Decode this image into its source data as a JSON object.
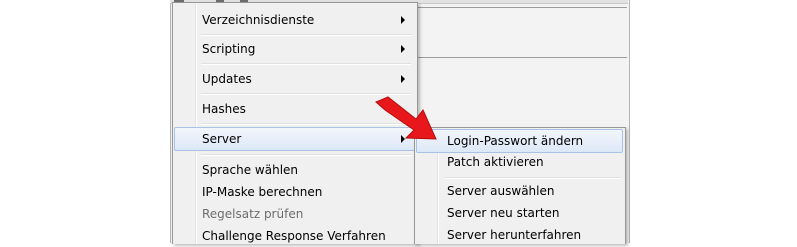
{
  "menu": {
    "items": [
      {
        "label": "Verzeichnisdienste",
        "submenu": true
      },
      {
        "label": "Scripting",
        "submenu": true
      },
      {
        "label": "Updates",
        "submenu": true
      },
      {
        "label": "Hashes",
        "submenu": false
      },
      {
        "label": "Server",
        "submenu": true,
        "state": "open"
      },
      {
        "label": "Sprache wählen",
        "submenu": false
      },
      {
        "label": "IP-Maske berechnen",
        "submenu": false
      },
      {
        "label": "Regelsatz prüfen",
        "submenu": false,
        "state": "disabled"
      },
      {
        "label": "Challenge Response Verfahren",
        "submenu": false
      }
    ]
  },
  "submenu": {
    "items": [
      {
        "label": "Login-Passwort ändern",
        "state": "highlighted"
      },
      {
        "label": "Patch aktivieren"
      },
      {
        "label": "Server auswählen"
      },
      {
        "label": "Server neu starten"
      },
      {
        "label": "Server herunterfahren"
      }
    ]
  },
  "colors": {
    "highlight_border": "#a9c1e3",
    "annotation_arrow": "#e8171b",
    "disabled_text": "#6d6d6d"
  },
  "icons": {
    "submenu_indicator": "chevron-right-icon",
    "annotation": "red-pointer-arrow-icon"
  }
}
